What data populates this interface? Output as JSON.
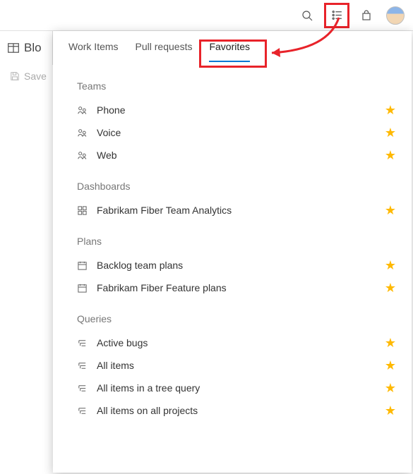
{
  "topbar": {
    "search_icon": "search",
    "list_icon": "list",
    "shop_icon": "shopping-bag"
  },
  "subheader": {
    "title": "Blo",
    "save_label": "Save"
  },
  "tabs": [
    {
      "label": "Work Items",
      "active": false
    },
    {
      "label": "Pull requests",
      "active": false
    },
    {
      "label": "Favorites",
      "active": true
    }
  ],
  "sections": [
    {
      "title": "Teams",
      "icon": "team",
      "items": [
        {
          "label": "Phone"
        },
        {
          "label": "Voice"
        },
        {
          "label": "Web"
        }
      ]
    },
    {
      "title": "Dashboards",
      "icon": "dashboard",
      "items": [
        {
          "label": "Fabrikam Fiber Team Analytics"
        }
      ]
    },
    {
      "title": "Plans",
      "icon": "plan",
      "items": [
        {
          "label": "Backlog team plans"
        },
        {
          "label": "Fabrikam Fiber Feature plans"
        }
      ]
    },
    {
      "title": "Queries",
      "icon": "query",
      "items": [
        {
          "label": "Active bugs"
        },
        {
          "label": "All items"
        },
        {
          "label": "All items in a tree query"
        },
        {
          "label": "All items on all projects"
        }
      ]
    }
  ]
}
